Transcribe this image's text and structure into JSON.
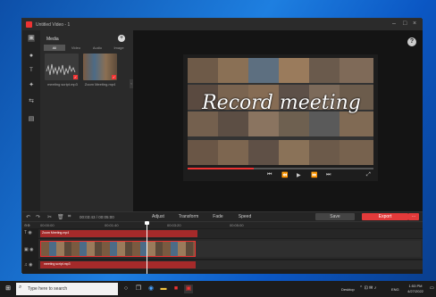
{
  "window": {
    "title": "Untitled Video - 1"
  },
  "media": {
    "heading": "Media",
    "tabs": [
      "All",
      "Video",
      "Audio",
      "Image"
    ],
    "items": [
      "meeting script.mp3",
      "Zoom Meeting.mp4"
    ]
  },
  "preview": {
    "overlay_text": "Record meeting"
  },
  "toolbar": {
    "timecode": "00:03:43 / 00:05:00",
    "tools": [
      "Adjust",
      "Transform",
      "Fade",
      "Speed"
    ],
    "save_label": "Save",
    "export_label": "Export"
  },
  "timeline": {
    "ticks": [
      "00:00:00",
      "00:01:40",
      "00:03:20",
      "00:05:00"
    ],
    "video_clip": "Zoom Meeting.mp4",
    "audio_clip": "meeting script.mp3",
    "playhead_fraction": 0.297
  },
  "taskbar": {
    "search_placeholder": "Type here to search",
    "desktop_label": "Desktop",
    "lang": "ENG",
    "time": "1:53 PM",
    "date": "4/27/2022"
  },
  "colors": {
    "accent": "#e33a3a",
    "window_bg": "#1b1b1b"
  }
}
